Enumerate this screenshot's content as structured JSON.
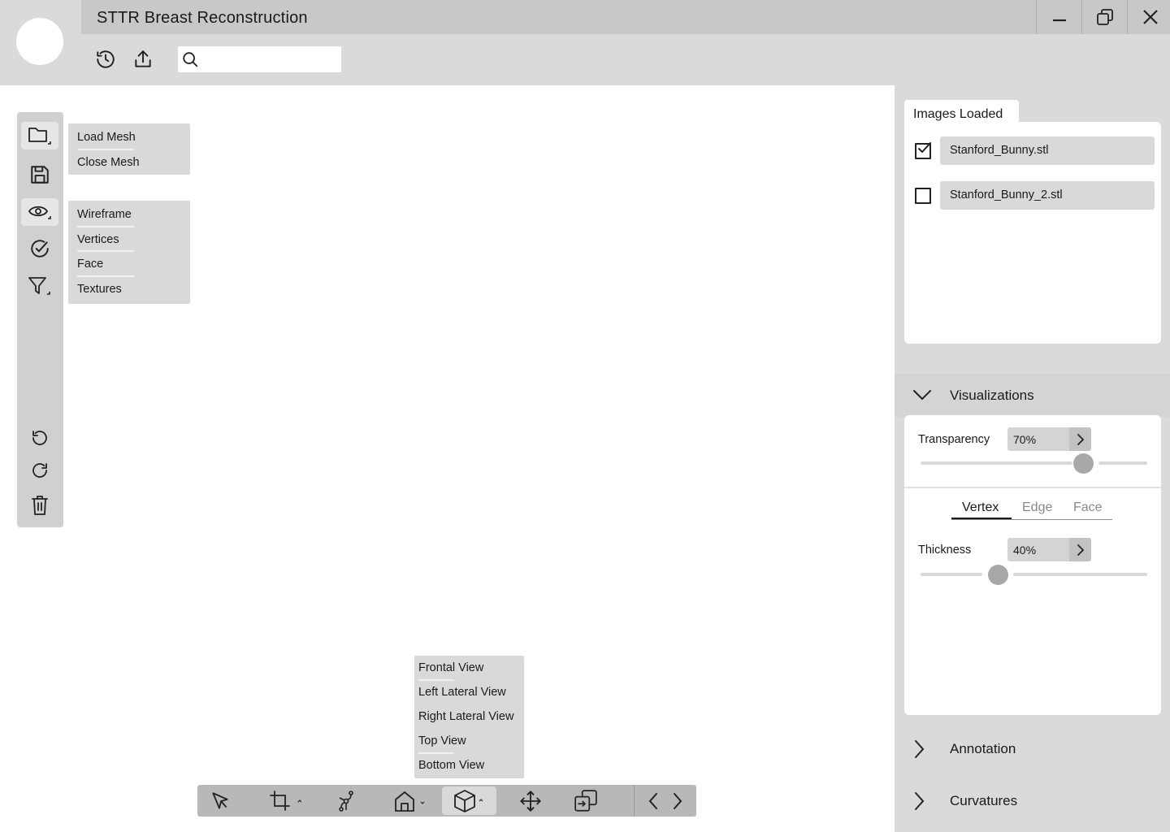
{
  "app": {
    "title": "STTR Breast Reconstruction"
  },
  "search": {
    "placeholder": "",
    "value": ""
  },
  "file_menu": {
    "items": [
      "Load Mesh",
      "Close Mesh"
    ]
  },
  "view_menu": {
    "items": [
      "Wireframe",
      "Vertices",
      "Face",
      "Textures"
    ]
  },
  "camera_menu": {
    "items": [
      "Frontal View",
      "Left Lateral View",
      "Right Lateral View",
      "Top View",
      "Bottom View"
    ]
  },
  "images_panel": {
    "tab_label": "Images Loaded",
    "files": [
      {
        "name": "Stanford_Bunny.stl",
        "checked": true
      },
      {
        "name": "Stanford_Bunny_2.stl",
        "checked": false
      }
    ]
  },
  "visualizations": {
    "label": "Visualizations",
    "expanded": true,
    "transparency": {
      "label": "Transparency",
      "value": "70%",
      "fraction": 0.7
    },
    "mode_tabs": [
      "Vertex",
      "Edge",
      "Face"
    ],
    "active_mode": "Vertex",
    "thickness": {
      "label": "Thickness",
      "value": "40%",
      "fraction": 0.4
    }
  },
  "annotation": {
    "label": "Annotation"
  },
  "curvatures": {
    "label": "Curvatures"
  },
  "icons": {
    "header": [
      "history-icon",
      "export-icon",
      "search-icon"
    ],
    "window": [
      "minimize-icon",
      "restore-icon",
      "close-icon"
    ],
    "left_toolbar": [
      "folder-icon",
      "save-icon",
      "eye-icon",
      "check-circle-icon",
      "filter-icon",
      "undo-icon",
      "redo-icon",
      "trash-icon"
    ],
    "bottom_toolbar": [
      "select-cursor-icon",
      "crop-icon",
      "vector-path-icon",
      "home-icon",
      "cube-icon",
      "move-icon",
      "import-icon",
      "prev-icon",
      "next-icon"
    ]
  },
  "colors": {
    "header": "#dadada",
    "titlebar": "#c8c8c8",
    "panel": "#dadada",
    "toolbar": "#d0d0d0",
    "accent_thumb": "#a8a8a8"
  }
}
